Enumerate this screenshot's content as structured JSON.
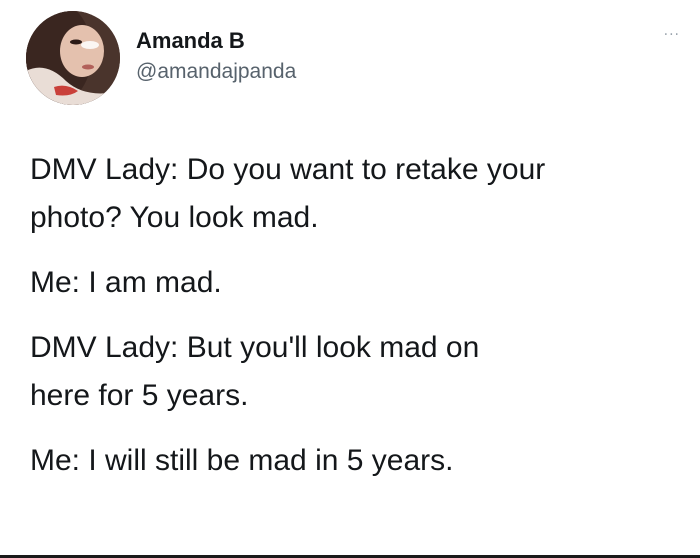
{
  "author": {
    "display_name": "Amanda B",
    "handle": "@amandajpanda",
    "avatar_icon": "profile-photo-avatar"
  },
  "menu": {
    "more_label": "···",
    "more_icon": "more-options-icon"
  },
  "tweet": {
    "paragraphs": [
      [
        "DMV Lady: Do you want to retake your",
        "photo? You look mad."
      ],
      [
        "Me: I am mad."
      ],
      [
        "DMV Lady: But you'll look mad on",
        "here for 5 years."
      ],
      [
        "Me: I will still be mad in 5 years."
      ]
    ]
  },
  "colors": {
    "text": "#14171a",
    "secondary": "#57626c",
    "background": "#ffffff"
  }
}
